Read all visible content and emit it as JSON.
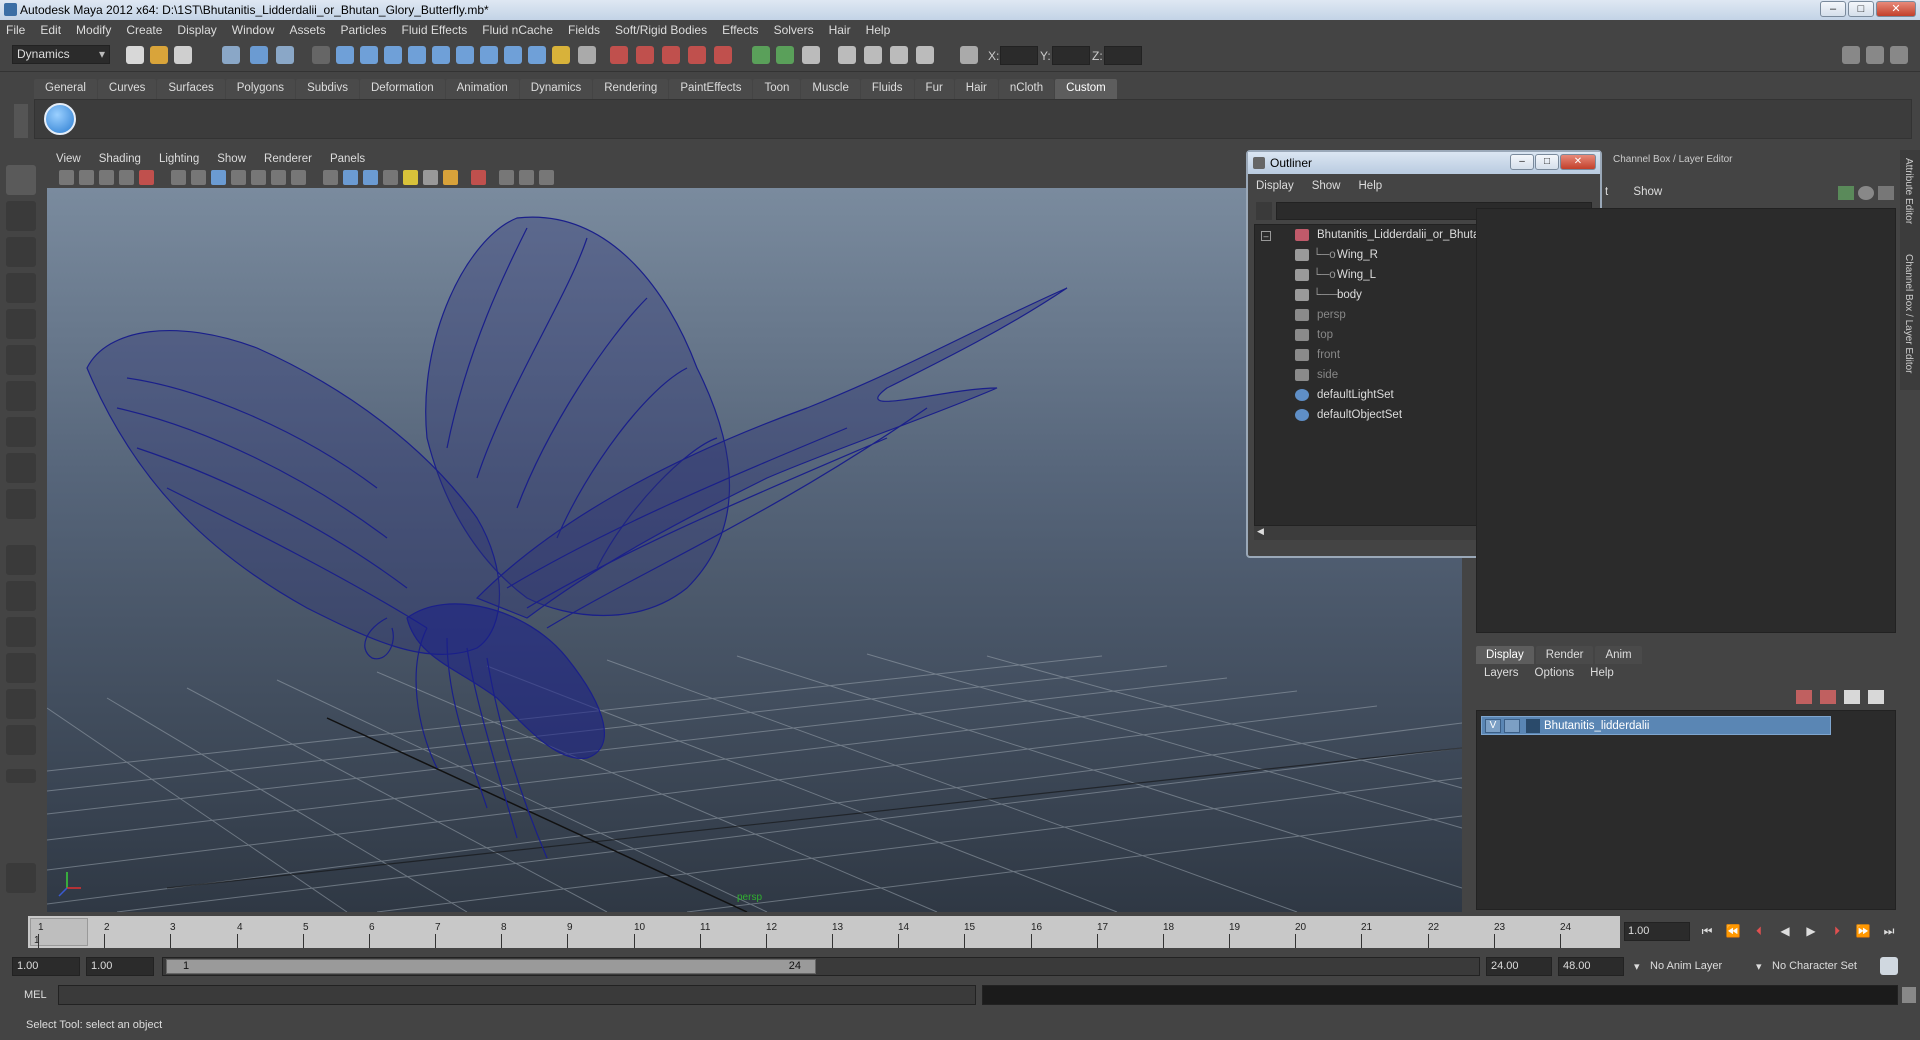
{
  "window": {
    "title": "Autodesk Maya 2012 x64: D:\\1ST\\Bhutanitis_Lidderdalii_or_Bhutan_Glory_Butterfly.mb*"
  },
  "menubar": [
    "File",
    "Edit",
    "Modify",
    "Create",
    "Display",
    "Window",
    "Assets",
    "Particles",
    "Fluid Effects",
    "Fluid nCache",
    "Fields",
    "Soft/Rigid Bodies",
    "Effects",
    "Solvers",
    "Hair",
    "Help"
  ],
  "statusline": {
    "menuset": "Dynamics",
    "x_label": "X:",
    "y_label": "Y:",
    "z_label": "Z:"
  },
  "shelf": {
    "tabs": [
      "General",
      "Curves",
      "Surfaces",
      "Polygons",
      "Subdivs",
      "Deformation",
      "Animation",
      "Dynamics",
      "Rendering",
      "PaintEffects",
      "Toon",
      "Muscle",
      "Fluids",
      "Fur",
      "Hair",
      "nCloth",
      "Custom"
    ],
    "active_tab": "Custom"
  },
  "panel": {
    "menu": [
      "View",
      "Shading",
      "Lighting",
      "Show",
      "Renderer",
      "Panels"
    ]
  },
  "outliner": {
    "title": "Outliner",
    "menu": [
      "Display",
      "Show",
      "Help"
    ],
    "items": [
      {
        "label": "Bhutanitis_Lidderdalii_or_Bhutan_Glory_Butterfly",
        "dim": false
      },
      {
        "label": "Wing_R",
        "dim": false
      },
      {
        "label": "Wing_L",
        "dim": false
      },
      {
        "label": "body",
        "dim": false
      },
      {
        "label": "persp",
        "dim": true
      },
      {
        "label": "top",
        "dim": true
      },
      {
        "label": "front",
        "dim": true
      },
      {
        "label": "side",
        "dim": true
      },
      {
        "label": "defaultLightSet",
        "dim": false
      },
      {
        "label": "defaultObjectSet",
        "dim": false
      }
    ]
  },
  "channelbox": {
    "header": "Channel Box / Layer Editor",
    "menu_partial": "t",
    "menu_show": "Show"
  },
  "sidetabs": {
    "attribute_editor": "Attribute Editor",
    "channel_box": "Channel Box / Layer Editor"
  },
  "layer_editor": {
    "tabs": [
      "Display",
      "Render",
      "Anim"
    ],
    "active_tab": "Display",
    "menu": [
      "Layers",
      "Options",
      "Help"
    ],
    "layer": {
      "visibility": "V",
      "name": "Bhutanitis_lidderdalii"
    }
  },
  "viewport": {
    "camera_label": "persp"
  },
  "timeslider": {
    "ticks": [
      "1",
      "2",
      "3",
      "4",
      "5",
      "6",
      "7",
      "8",
      "9",
      "10",
      "11",
      "12",
      "13",
      "14",
      "15",
      "16",
      "17",
      "18",
      "19",
      "20",
      "21",
      "22",
      "23",
      "24"
    ],
    "current_marker": "1",
    "current_frame": "1.00"
  },
  "range": {
    "start": "1.00",
    "playback_start": "1.00",
    "handle_start": "1",
    "handle_end": "24",
    "playback_end": "24.00",
    "end": "48.00",
    "anim_layer": "No Anim Layer",
    "character_set": "No Character Set"
  },
  "command_line": {
    "label": "MEL"
  },
  "help_line": "Select Tool: select an object",
  "colors": {
    "wireframe": "#1a1f8a",
    "viewport_top": "#7a8b9e",
    "viewport_bottom": "#2f3844",
    "selection": "#5a86b4"
  }
}
